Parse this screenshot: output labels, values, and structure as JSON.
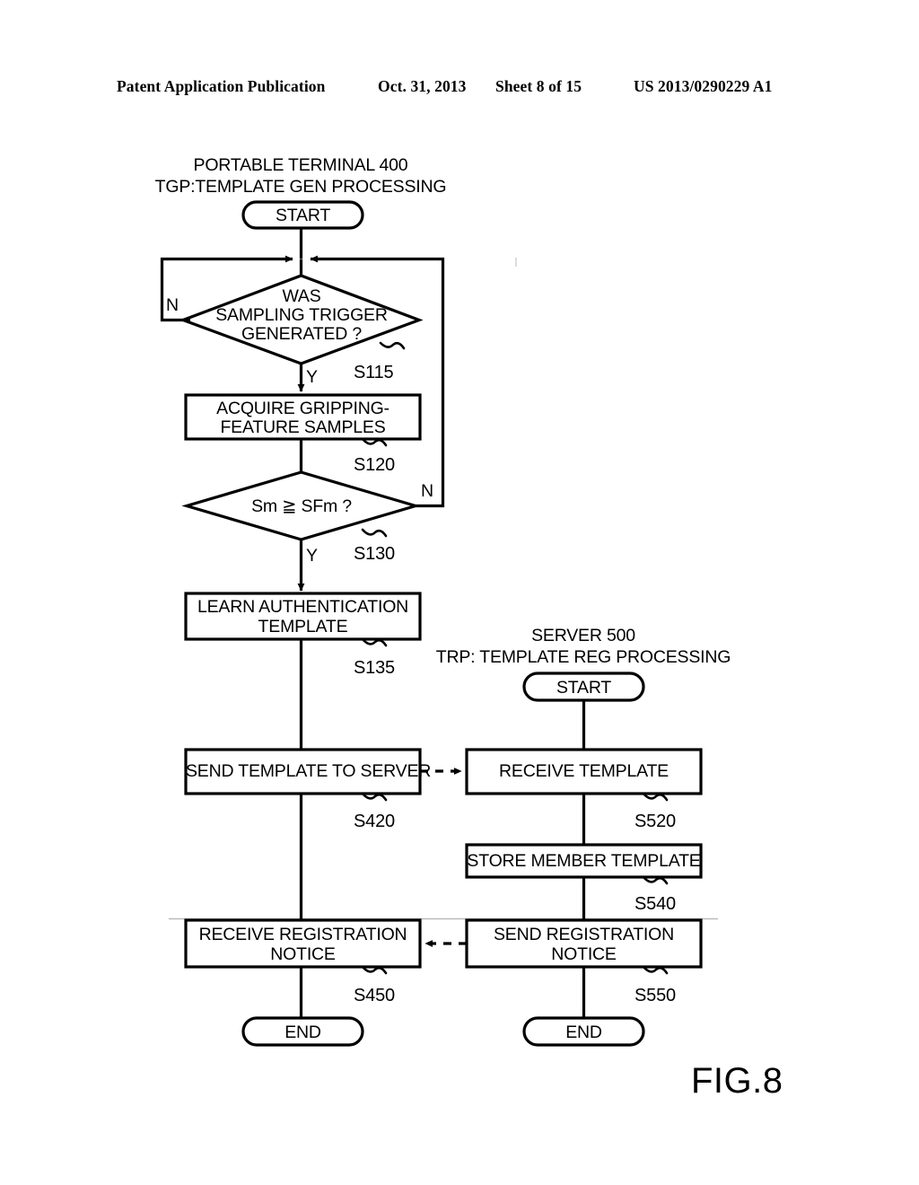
{
  "header": {
    "publication": "Patent Application Publication",
    "date": "Oct. 31, 2013",
    "sheet": "Sheet 8 of 15",
    "patent_number": "US 2013/0290229 A1"
  },
  "figure": {
    "caption": "FIG.8",
    "ink_color": "#000000",
    "background_color": "#ffffff"
  },
  "left_column": {
    "title_line1": "PORTABLE TERMINAL 400",
    "title_line2": "TGP:TEMPLATE GEN PROCESSING",
    "start_label": "START",
    "end_label": "END",
    "nodes": [
      {
        "id": "s115",
        "type": "decision",
        "text_line1": "WAS",
        "text_line2": "SAMPLING TRIGGER",
        "text_line3": "GENERATED ?",
        "step": "S115",
        "yes_label": "Y",
        "no_label": "N"
      },
      {
        "id": "s120",
        "type": "process",
        "text_line1": "ACQUIRE GRIPPING-",
        "text_line2": "FEATURE SAMPLES",
        "step": "S120"
      },
      {
        "id": "s130",
        "type": "decision",
        "text_line1": "Sm ≧ SFm ?",
        "step": "S130",
        "yes_label": "Y",
        "no_label": "N"
      },
      {
        "id": "s135",
        "type": "process",
        "text_line1": "LEARN AUTHENTICATION",
        "text_line2": "TEMPLATE",
        "step": "S135"
      },
      {
        "id": "s420",
        "type": "process",
        "text_line1": "SEND TEMPLATE TO SERVER",
        "step": "S420"
      },
      {
        "id": "s450",
        "type": "process",
        "text_line1": "RECEIVE REGISTRATION",
        "text_line2": "NOTICE",
        "step": "S450"
      }
    ]
  },
  "right_column": {
    "title_line1": "SERVER 500",
    "title_line2": "TRP: TEMPLATE REG PROCESSING",
    "start_label": "START",
    "end_label": "END",
    "nodes": [
      {
        "id": "s520",
        "type": "process",
        "text_line1": "RECEIVE TEMPLATE",
        "step": "S520"
      },
      {
        "id": "s540",
        "type": "process",
        "text_line1": "STORE MEMBER TEMPLATE",
        "step": "S540"
      },
      {
        "id": "s550",
        "type": "process",
        "text_line1": "SEND REGISTRATION",
        "text_line2": "NOTICE",
        "step": "S550"
      }
    ]
  },
  "connectors": [
    {
      "id": "send-to-receive-template",
      "style": "dashed",
      "direction": "right",
      "from": "s420",
      "to": "s520"
    },
    {
      "id": "send-to-receive-notice",
      "style": "dashed",
      "direction": "left",
      "from": "s550",
      "to": "s450"
    },
    {
      "id": "s115-no-loop",
      "style": "solid",
      "direction": "loop-left",
      "from": "s115",
      "to": "junction"
    },
    {
      "id": "s130-no-loop",
      "style": "solid",
      "direction": "loop-right",
      "from": "s130",
      "to": "junction"
    }
  ]
}
